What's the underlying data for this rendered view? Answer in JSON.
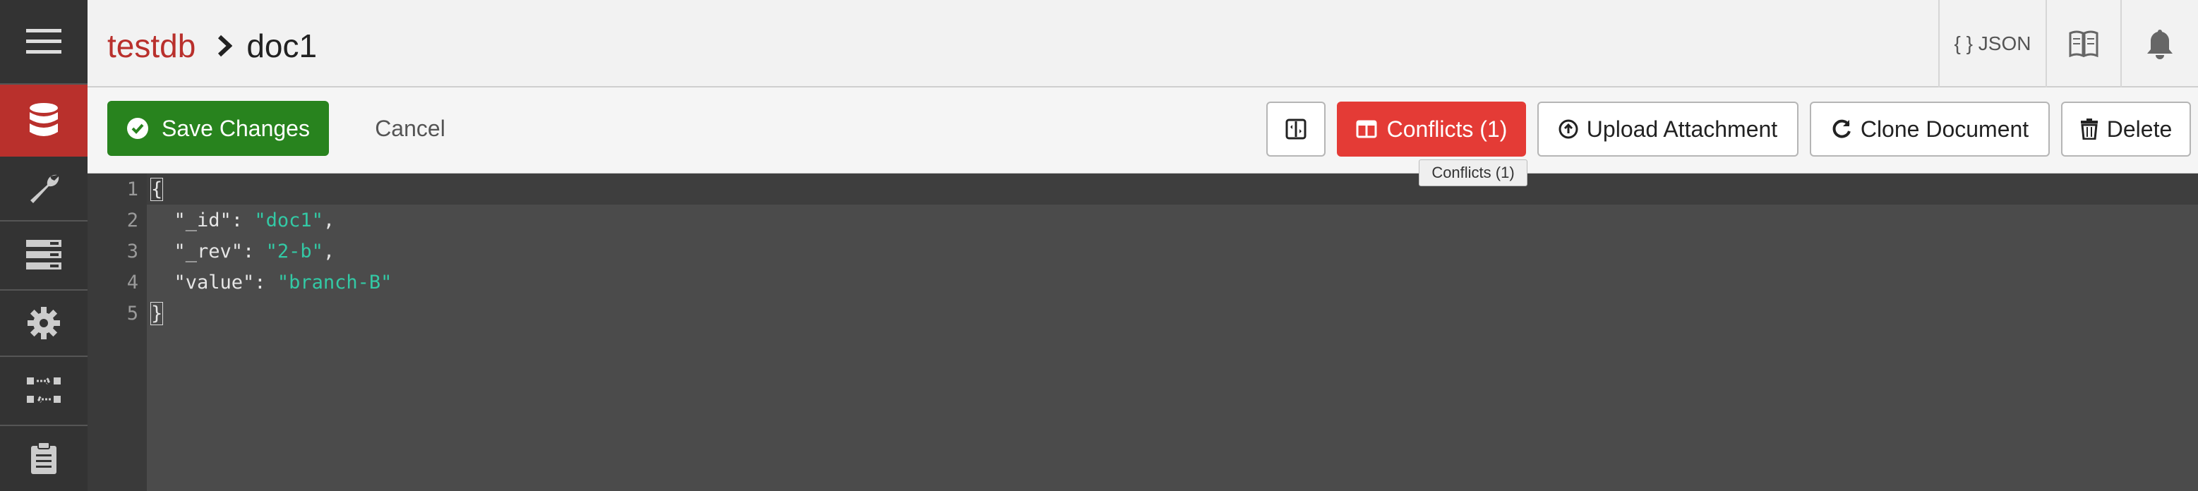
{
  "breadcrumb": {
    "database": "testdb",
    "document": "doc1"
  },
  "header": {
    "json_label": "{ } JSON"
  },
  "toolbar": {
    "save_label": "Save Changes",
    "cancel_label": "Cancel",
    "conflicts_label": "Conflicts (1)",
    "upload_label": "Upload Attachment",
    "clone_label": "Clone Document",
    "delete_label": "Delete"
  },
  "tooltip": {
    "text": "Conflicts (1)"
  },
  "editor": {
    "line_numbers": [
      "1",
      "2",
      "3",
      "4",
      "5"
    ],
    "line1": "{",
    "line2_key": "  \"_id\": ",
    "line2_val": "\"doc1\"",
    "line2_end": ",",
    "line3_key": "  \"_rev\": ",
    "line3_val": "\"2-b\"",
    "line3_end": ",",
    "line4_key": "  \"value\": ",
    "line4_val": "\"branch-B\"",
    "line5": "}"
  },
  "colors": {
    "brand_red": "#b9302c",
    "save_green": "#28831e",
    "conflict_red": "#e43b36",
    "json_string": "#33c9a5"
  },
  "icons": {
    "sidebar": [
      "menu-icon",
      "database-icon",
      "wrench-icon",
      "tables-icon",
      "gear-icon",
      "replicate-icon",
      "clipboard-icon"
    ],
    "header": [
      "book-icon",
      "bell-icon"
    ],
    "toolbar": [
      "check-circle-icon",
      "split-view-icon",
      "columns-icon",
      "upload-icon",
      "refresh-icon",
      "trash-icon"
    ]
  }
}
